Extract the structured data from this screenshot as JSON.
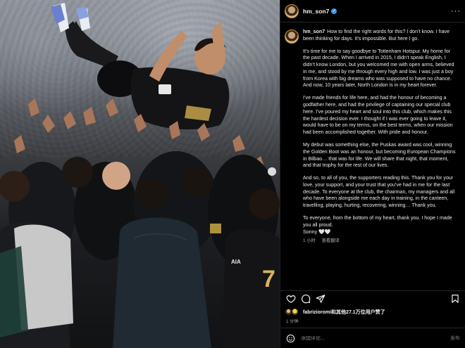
{
  "post": {
    "username": "hm_son7",
    "caption_paragraphs": [
      "How to find the right words for this? I don’t know. I have been thinking for days. It’s impossible. But here I go.",
      "It’s time for me to say goodbye to Tottenham Hotspur. My home for the past decade. When I arrived in 2015, I didn’t speak English, I didn’t know London, but you welcomed me with open arms, believed in me, and stood by me through every high and low. I was just a boy from Korea with big dreams who was supposed to have no chance. And now, 10 years later, North London is in my heart forever.",
      "I’ve made friends for life here, and had the honour of becoming a godfather here, and had the privilege of captaining our special club here. I’ve poured my heart and soul into this club, which makes this the hardest decision ever. I thought if I was ever going to leave it, would have to be on my terms, on the best terms, when our mission had been accomplished together. With pride and honour.",
      "My debut was something else, the Puskas award was cool, winning the Golden Boot was an honour, but becoming European Champions in Bilbao… that was for life. We will share that night, that moment, and that trophy for the rest of our lives.",
      "And so, to all of you, the supporters reading this. Thank you for your love, your support, and your trust that you’ve had in me for the last decade. To everyone at the club, the chairman, my managers and all who have been alongside me each day in training, in the canteen, travelling, playing, hurting, recovering, winning… Thank you.",
      "To everyone, from the bottom of my heart, thank you. I hope I made you all proud.\nSonny 🤍🤍"
    ],
    "time_ago": "1 小时",
    "translate_label": "查看翻译",
    "likes_text": "fabrizioromi和其他27.1万位用户赞了",
    "date": "1 分钟",
    "comment_placeholder": "添加评论...",
    "post_button": "发布",
    "player_number": "7"
  },
  "icons": {
    "like": "heart-icon",
    "comment": "comment-icon",
    "share": "send-icon",
    "save": "bookmark-icon",
    "emoji": "smiley-icon",
    "verified": "verified-badge-icon",
    "more": "more-options-icon"
  },
  "colors": {
    "background": "#000000",
    "verified": "#3897f0",
    "muted_text": "#a8a8a8",
    "divider": "#262626"
  }
}
